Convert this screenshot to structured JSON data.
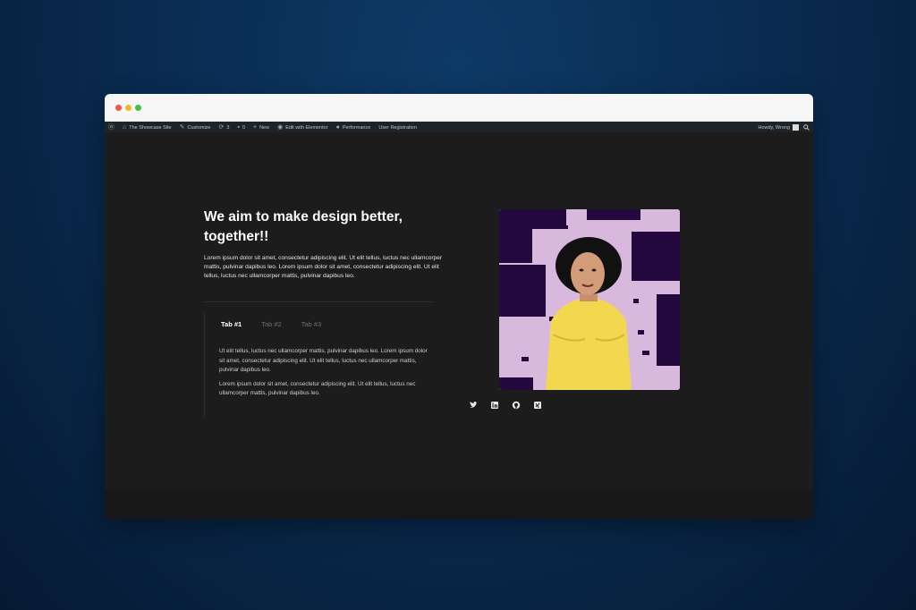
{
  "admin_bar": {
    "site_name": "The Showcase Site",
    "customize": "Customize",
    "updates_count": "3",
    "comments_count": "0",
    "new_label": "New",
    "edit_label": "Edit with Elementor",
    "performance_label": "Performance",
    "user_registration_label": "User Registration",
    "greeting": "Howdy, Wrong"
  },
  "hero": {
    "headline": "We aim to make design better, together!!",
    "intro": "Lorem ipsum dolor sit amet, consectetur adipiscing elit. Ut elit tellus, luctus nec ullamcorper mattis, pulvinar dapibus leo. Lorem ipsum dolor sit amet, consectetur adipiscing elit. Ut elit tellus, luctus nec ullamcorper mattis, pulvinar dapibus leo."
  },
  "tabs": {
    "items": [
      {
        "label": "Tab #1",
        "active": true
      },
      {
        "label": "Tab #2",
        "active": false
      },
      {
        "label": "Tab #3",
        "active": false
      }
    ],
    "content": [
      "Ut elit tellus, luctus nec ullamcorper mattis, pulvinar dapibus leo. Lorem ipsum dolor sit amet, consectetur adipiscing elit. Ut elit tellus, luctus nec ullamcorper mattis, pulvinar dapibus leo.",
      "Lorem ipsum dolor sit amet, consectetur adipiscing elit. Ut elit tellus, luctus nec ullamcorper mattis, pulvinar dapibus leo."
    ]
  },
  "social": [
    "twitter-icon",
    "linkedin-icon",
    "github-icon",
    "xing-icon"
  ],
  "colors": {
    "page_bg": "#1c1c1c",
    "art_bg": "#d7b6dc",
    "art_dark": "#24093f",
    "sweater": "#f1d84e"
  }
}
